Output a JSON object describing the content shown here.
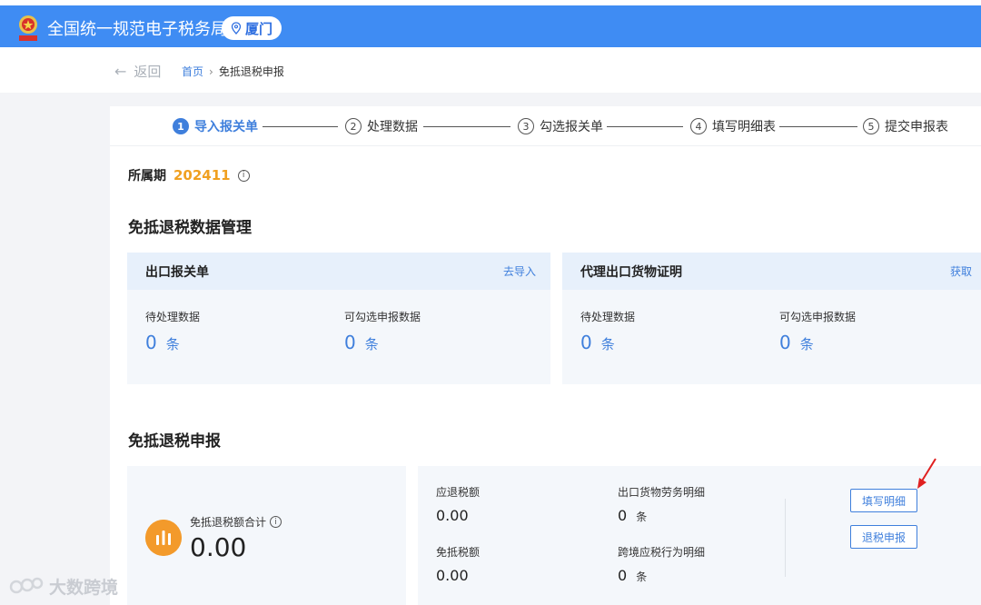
{
  "header": {
    "app_title": "全国统一规范电子税务局",
    "city": "厦门",
    "emblem_icon": "tax-emblem-icon",
    "pin_icon": "location-pin-icon"
  },
  "nav": {
    "back_label": "返回",
    "breadcrumb": {
      "home": "首页",
      "separator": "›",
      "current": "免抵退税申报"
    }
  },
  "steps": [
    {
      "num": "1",
      "label": "导入报关单",
      "active": true
    },
    {
      "num": "2",
      "label": "处理数据"
    },
    {
      "num": "3",
      "label": "勾选报关单"
    },
    {
      "num": "4",
      "label": "填写明细表"
    },
    {
      "num": "5",
      "label": "提交申报表"
    }
  ],
  "period": {
    "label": "所属期",
    "value": "202411",
    "info_icon": "ⓘ"
  },
  "data_mgmt": {
    "title": "免抵退税数据管理",
    "cards": [
      {
        "title": "出口报关单",
        "action": "去导入",
        "stats": [
          {
            "label": "待处理数据",
            "value": "0",
            "unit": "条"
          },
          {
            "label": "可勾选申报数据",
            "value": "0",
            "unit": "条"
          }
        ]
      },
      {
        "title": "代理出口货物证明",
        "action": "获取",
        "stats": [
          {
            "label": "待处理数据",
            "value": "0",
            "unit": "条"
          },
          {
            "label": "可勾选申报数据",
            "value": "0",
            "unit": "条"
          }
        ]
      }
    ]
  },
  "declaration": {
    "title": "免抵退税申报",
    "total": {
      "label": "免抵退税额合计",
      "info_icon": "ⓘ",
      "value": "0.00"
    },
    "detail": {
      "refund_label": "应退税额",
      "refund_value": "0.00",
      "exempt_label": "免抵税额",
      "exempt_value": "0.00",
      "goods_label": "出口货物劳务明细",
      "goods_value": "0",
      "goods_unit": "条",
      "crossborder_label": "跨境应税行为明细",
      "crossborder_value": "0",
      "crossborder_unit": "条"
    },
    "buttons": {
      "fill": "填写明细",
      "submit": "退税申报"
    }
  },
  "watermark": {
    "text": "大数跨境"
  },
  "colors": {
    "header_blue": "#3f8cf3",
    "accent_blue": "#3f7fdc",
    "period_orange": "#f0a020",
    "icon_orange": "#f39a2b",
    "arrow_red": "#e02020"
  }
}
